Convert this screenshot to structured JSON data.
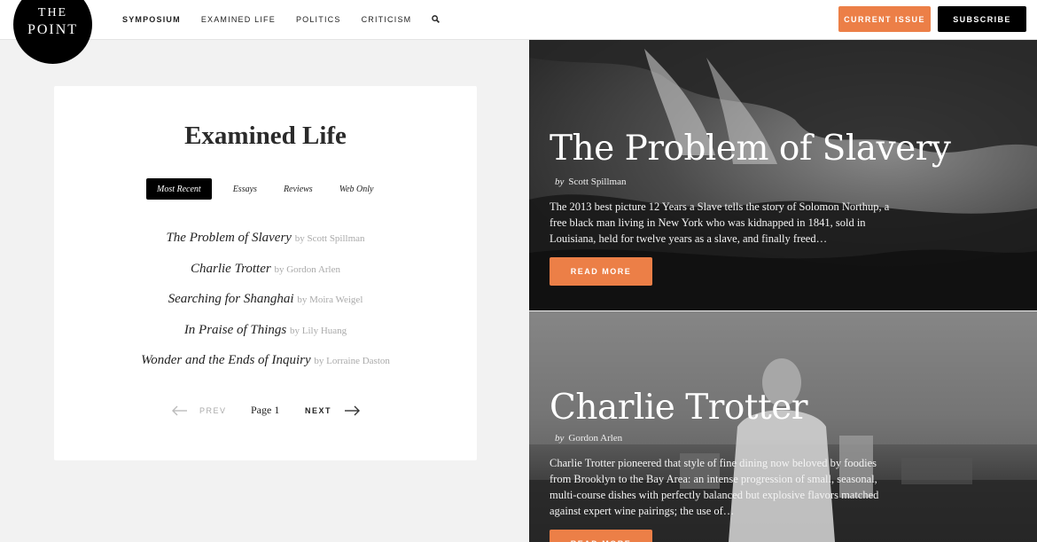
{
  "logo": {
    "line1": "THE",
    "line2": "POINT"
  },
  "nav": {
    "items": [
      {
        "label": "SYMPOSIUM",
        "active": true
      },
      {
        "label": "EXAMINED LIFE",
        "active": false
      },
      {
        "label": "POLITICS",
        "active": false
      },
      {
        "label": "CRITICISM",
        "active": false
      }
    ],
    "search_icon": "search-icon",
    "current_issue": "CURRENT ISSUE",
    "subscribe": "SUBSCRIBE"
  },
  "section": {
    "title": "Examined Life",
    "tabs": [
      {
        "label": "Most Recent",
        "active": true
      },
      {
        "label": "Essays",
        "active": false
      },
      {
        "label": "Reviews",
        "active": false
      },
      {
        "label": "Web Only",
        "active": false
      }
    ],
    "articles": [
      {
        "title": "The Problem of Slavery",
        "by": "by Scott Spillman"
      },
      {
        "title": "Charlie Trotter",
        "by": "by Gordon Arlen"
      },
      {
        "title": "Searching for Shanghai",
        "by": "by Moira Weigel"
      },
      {
        "title": "In Praise of Things",
        "by": "by Lily Huang"
      },
      {
        "title": "Wonder and the Ends of Inquiry",
        "by": "by Lorraine Daston"
      }
    ],
    "pager": {
      "prev": "PREV",
      "page": "Page 1",
      "next": "NEXT"
    }
  },
  "features": [
    {
      "title": "The Problem of Slavery",
      "by_prefix": "by",
      "author": "Scott Spillman",
      "description": "The 2013 best picture 12 Years a Slave tells the story of Solomon Northup, a free black man living in New York who was kidnapped in 1841, sold in Louisiana, held for twelve years as a slave, and finally freed…",
      "button": "READ MORE"
    },
    {
      "title": "Charlie Trotter",
      "by_prefix": "by",
      "author": "Gordon Arlen",
      "description": "Charlie Trotter pioneered that style of fine dining now beloved by foodies from Brooklyn to the Bay Area: an intense progression of small, seasonal, multi-course dishes with perfectly balanced but explosive flavors matched against expert wine pairings; the use of…",
      "button": "READ MORE"
    }
  ],
  "colors": {
    "accent": "#ec7f47",
    "dark": "#000000",
    "background": "#f2f2f2"
  }
}
